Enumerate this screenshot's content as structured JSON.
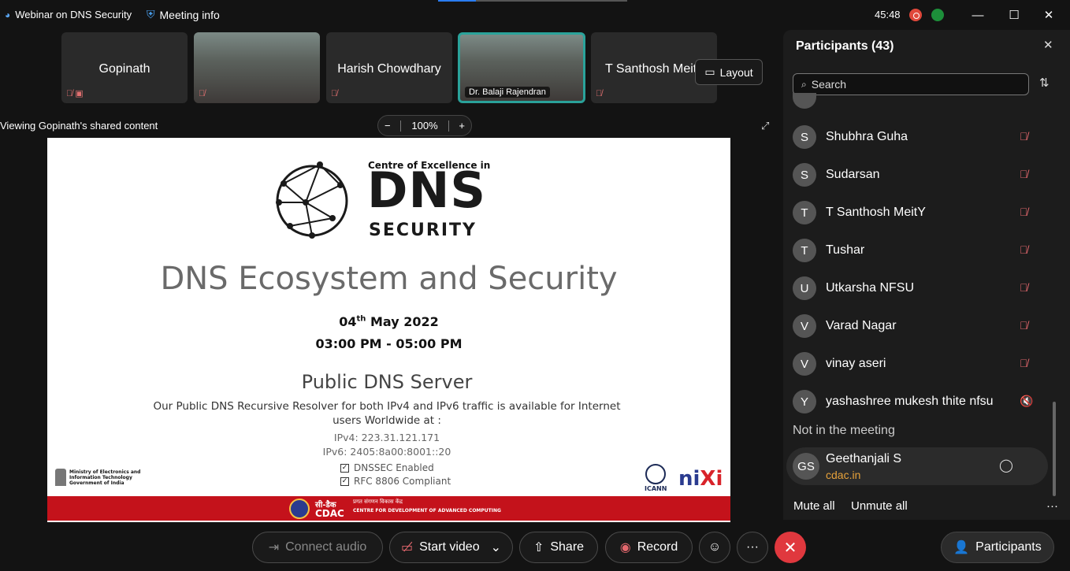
{
  "titlebar": {
    "app_title": "Webinar on DNS Security",
    "meeting_info": "Meeting info",
    "timer": "45:48"
  },
  "tiles": [
    {
      "name": "Gopinath"
    },
    {
      "name": ""
    },
    {
      "name": "Harish Chowdhary"
    },
    {
      "name": "Dr. Balaji Rajendran"
    },
    {
      "name": "T Santhosh MeitY"
    }
  ],
  "layout_label": "Layout",
  "share": {
    "viewing": "Viewing Gopinath's shared content",
    "zoom": "100%",
    "zoom_minus": "−",
    "zoom_plus": "+"
  },
  "slide": {
    "coe": "Centre of Excellence in",
    "dns": "DNS",
    "security": "SECURITY",
    "title": "DNS Ecosystem and Security",
    "date_day": "04",
    "date_sup": "th",
    "date_rest": " May 2022",
    "time": "03:00 PM - 05:00 PM",
    "public": "Public DNS Server",
    "desc": "Our Public DNS Recursive Resolver for both IPv4 and IPv6 traffic is available for Internet users Worldwide at :",
    "ipv4": "IPv4: 223.31.121.171",
    "ipv6": "IPv6: 2405:8a00:8001::20",
    "check1": "DNSSEC Enabled",
    "check2": "RFC 8806 Compliant",
    "meity_line1": "Ministry of Electronics and",
    "meity_line2": "Information Technology",
    "meity_line3": "Government of India",
    "icann": "ICANN",
    "nixi_ni": "ni",
    "nixi_xi": "Xi",
    "footer_hindi": "सी-डैक",
    "footer_cdac": "CDAC",
    "footer_hindi2": "प्रगत संगणन विकास केंद्र",
    "footer_eng": "CENTRE FOR DEVELOPMENT OF ADVANCED COMPUTING"
  },
  "toolbar": {
    "connect_audio": "Connect audio",
    "start_video": "Start video",
    "share": "Share",
    "record": "Record",
    "more": "···",
    "end": "✕",
    "participants": "Participants"
  },
  "panel": {
    "title": "Participants (43)",
    "search_placeholder": "Search",
    "participants": [
      {
        "initial": "S",
        "name": "Shubhra Guha",
        "mic": "muted"
      },
      {
        "initial": "S",
        "name": "Sudarsan",
        "mic": "muted"
      },
      {
        "initial": "T",
        "name": "T Santhosh MeitY",
        "mic": "muted"
      },
      {
        "initial": "T",
        "name": "Tushar",
        "mic": "muted"
      },
      {
        "initial": "U",
        "name": "Utkarsha NFSU",
        "mic": "muted"
      },
      {
        "initial": "V",
        "name": "Varad Nagar",
        "mic": "muted"
      },
      {
        "initial": "V",
        "name": "vinay aseri",
        "mic": "muted"
      },
      {
        "initial": "Y",
        "name": "yashashree mukesh thite nfsu",
        "mic": "speaker-muted"
      }
    ],
    "not_in_meeting": "Not in the meeting",
    "guest": {
      "initials": "GS",
      "name": "Geethanjali S",
      "org": "cdac.in"
    },
    "mute_all": "Mute all",
    "unmute_all": "Unmute all",
    "more": "···"
  },
  "colors": {
    "accent_teal": "#2aa29a",
    "end_red": "#e0383e",
    "mute_red": "#e5686e",
    "org_orange": "#e6a13a",
    "slide_footer_red": "#c4121b"
  }
}
